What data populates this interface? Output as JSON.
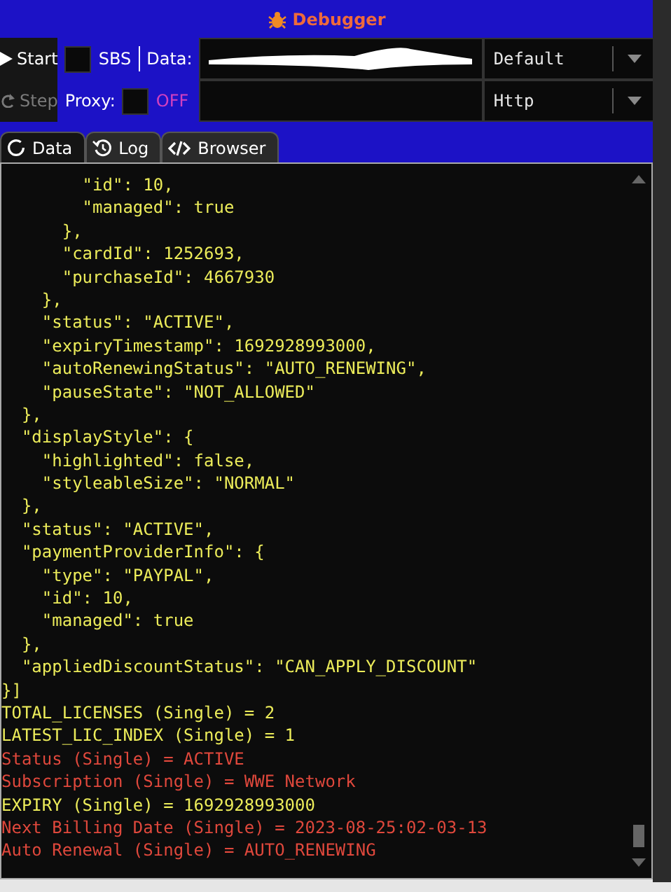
{
  "window": {
    "title": "Debugger"
  },
  "toolbar": {
    "buttons": [
      {
        "label": "Start",
        "disabled": false
      },
      {
        "label": "Step",
        "disabled": true
      }
    ],
    "sbs": {
      "label": "SBS",
      "checked": false
    },
    "data_field": {
      "label": "Data:",
      "redacted": true
    },
    "data_mode": {
      "value": "Default"
    },
    "proxy": {
      "label": "Proxy:",
      "checked": false,
      "state": "OFF"
    },
    "proxy_mode": {
      "value": "Http"
    }
  },
  "tabs": [
    {
      "label": "Data",
      "selected": true
    },
    {
      "label": "Log",
      "selected": false
    },
    {
      "label": "Browser",
      "selected": false
    }
  ],
  "output": {
    "lines": [
      {
        "text": "        \"id\": 10,",
        "color": "#ecec5a"
      },
      {
        "text": "        \"managed\": true",
        "color": "#ecec5a"
      },
      {
        "text": "      },",
        "color": "#ecec5a"
      },
      {
        "text": "      \"cardId\": 1252693,",
        "color": "#ecec5a"
      },
      {
        "text": "      \"purchaseId\": 4667930",
        "color": "#ecec5a"
      },
      {
        "text": "    },",
        "color": "#ecec5a"
      },
      {
        "text": "    \"status\": \"ACTIVE\",",
        "color": "#ecec5a"
      },
      {
        "text": "    \"expiryTimestamp\": 1692928993000,",
        "color": "#ecec5a"
      },
      {
        "text": "    \"autoRenewingStatus\": \"AUTO_RENEWING\",",
        "color": "#ecec5a"
      },
      {
        "text": "    \"pauseState\": \"NOT_ALLOWED\"",
        "color": "#ecec5a"
      },
      {
        "text": "  },",
        "color": "#ecec5a"
      },
      {
        "text": "  \"displayStyle\": {",
        "color": "#ecec5a"
      },
      {
        "text": "    \"highlighted\": false,",
        "color": "#ecec5a"
      },
      {
        "text": "    \"styleableSize\": \"NORMAL\"",
        "color": "#ecec5a"
      },
      {
        "text": "  },",
        "color": "#ecec5a"
      },
      {
        "text": "  \"status\": \"ACTIVE\",",
        "color": "#ecec5a"
      },
      {
        "text": "  \"paymentProviderInfo\": {",
        "color": "#ecec5a"
      },
      {
        "text": "    \"type\": \"PAYPAL\",",
        "color": "#ecec5a"
      },
      {
        "text": "    \"id\": 10,",
        "color": "#ecec5a"
      },
      {
        "text": "    \"managed\": true",
        "color": "#ecec5a"
      },
      {
        "text": "  },",
        "color": "#ecec5a"
      },
      {
        "text": "  \"appliedDiscountStatus\": \"CAN_APPLY_DISCOUNT\"",
        "color": "#ecec5a"
      },
      {
        "text": "}]",
        "color": "#ecec5a"
      },
      {
        "text": "TOTAL_LICENSES (Single) = 2",
        "color": "#ecec5a"
      },
      {
        "text": "LATEST_LIC_INDEX (Single) = 1",
        "color": "#ecec5a"
      },
      {
        "text": "Status (Single) = ACTIVE",
        "color": "#e0483c"
      },
      {
        "text": "Subscription (Single) = WWE Network",
        "color": "#e0483c"
      },
      {
        "text": "EXPIRY (Single) = 1692928993000",
        "color": "#ecec5a"
      },
      {
        "text": "Next Billing Date (Single) = 2023-08-25:02-03-13",
        "color": "#e0483c"
      },
      {
        "text": "Auto Renewal (Single) = AUTO_RENEWING",
        "color": "#e0483c"
      }
    ]
  }
}
